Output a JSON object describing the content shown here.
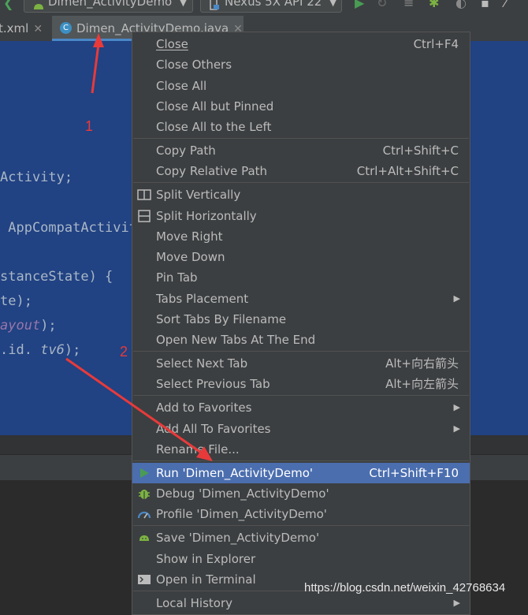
{
  "toolbar": {
    "config_label": "Dimen_ActivityDemo",
    "device_label": "Nexus 5X API 22"
  },
  "tabs": [
    {
      "label": "t.xml"
    },
    {
      "label": "Dimen_ActivityDemo.java"
    }
  ],
  "code": {
    "line1": "Activity;",
    "line2": " AppCompatActivit",
    "line3": "stanceState) {",
    "line4": "te);",
    "line5a": "ayout",
    "line5b": ");",
    "line6a": ".id.",
    "line6b": "tv6",
    "line6c": ");"
  },
  "annotations": {
    "label1": "1",
    "label2": "2"
  },
  "menu": {
    "close": {
      "label": "Close",
      "shortcut": "Ctrl+F4"
    },
    "close_others": {
      "label": "Close Others"
    },
    "close_all": {
      "label": "Close All"
    },
    "close_all_but_pinned": {
      "label": "Close All but Pinned"
    },
    "close_all_left": {
      "label": "Close All to the Left"
    },
    "copy_path": {
      "label": "Copy Path",
      "shortcut": "Ctrl+Shift+C"
    },
    "copy_relative_path": {
      "label": "Copy Relative Path",
      "shortcut": "Ctrl+Alt+Shift+C"
    },
    "split_vertically": {
      "label": "Split Vertically"
    },
    "split_horizontally": {
      "label": "Split Horizontally"
    },
    "move_right": {
      "label": "Move Right"
    },
    "move_down": {
      "label": "Move Down"
    },
    "pin_tab": {
      "label": "Pin Tab"
    },
    "tabs_placement": {
      "label": "Tabs Placement"
    },
    "sort_tabs": {
      "label": "Sort Tabs By Filename"
    },
    "open_new_tabs_end": {
      "label": "Open New Tabs At The End"
    },
    "select_next_tab": {
      "label": "Select Next Tab",
      "shortcut": "Alt+向右箭头"
    },
    "select_previous_tab": {
      "label": "Select Previous Tab",
      "shortcut": "Alt+向左箭头"
    },
    "add_to_favorites": {
      "label": "Add to Favorites"
    },
    "add_all_favorites": {
      "label": "Add All To Favorites"
    },
    "rename_file": {
      "label": "Rename File..."
    },
    "run": {
      "label": "Run 'Dimen_ActivityDemo'",
      "shortcut": "Ctrl+Shift+F10"
    },
    "debug": {
      "label": "Debug 'Dimen_ActivityDemo'"
    },
    "profile": {
      "label": "Profile 'Dimen_ActivityDemo'"
    },
    "save": {
      "label": "Save 'Dimen_ActivityDemo'"
    },
    "show_in_explorer": {
      "label": "Show in Explorer"
    },
    "open_in_terminal": {
      "label": "Open in Terminal"
    },
    "local_history": {
      "label": "Local History"
    }
  },
  "watermark": "https://blog.csdn.net/weixin_42768634",
  "colors": {
    "menu_bg": "#3c3f41",
    "selection": "#4b6eaf",
    "editor_selection": "#214283",
    "annotation_red": "#e83a3a",
    "run_green": "#499c54",
    "android_green": "#7cb342"
  }
}
